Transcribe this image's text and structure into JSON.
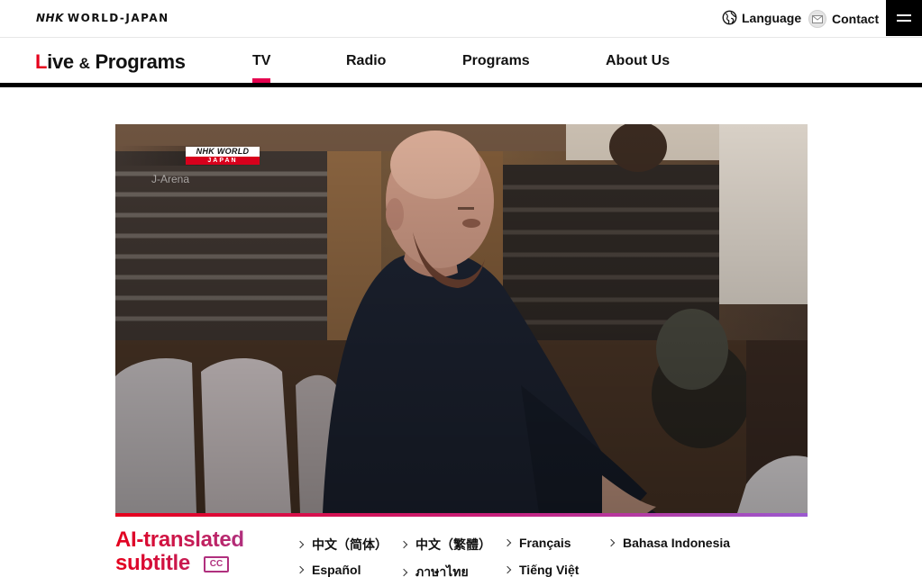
{
  "header": {
    "logo_mark": "NHK",
    "logo_text": "WORLD-JAPAN",
    "language_label": "Language",
    "contact_label": "Contact"
  },
  "nav": {
    "brand_initial": "L",
    "brand_rest": "ive",
    "brand_amp": "&",
    "brand_tail": "Programs",
    "items": [
      {
        "label": "TV",
        "active": true
      },
      {
        "label": "Radio"
      },
      {
        "label": "Programs"
      },
      {
        "label": "About Us"
      }
    ]
  },
  "video": {
    "watermark_top": "NHK WORLD",
    "watermark_bottom": "JAPAN",
    "program_name": "J-Arena"
  },
  "subtitles": {
    "title_line1": "AI-translated",
    "title_line2": "subtitle",
    "cc_label": "CC",
    "languages": [
      "中文（简体）",
      "中文（繁體）",
      "Français",
      "Bahasa Indonesia",
      "Español",
      "ภาษาไทย",
      "Tiếng Việt"
    ]
  },
  "colors": {
    "accent_red": "#e5001c",
    "accent_pink": "#e5004f",
    "accent_purple": "#b0307e"
  }
}
